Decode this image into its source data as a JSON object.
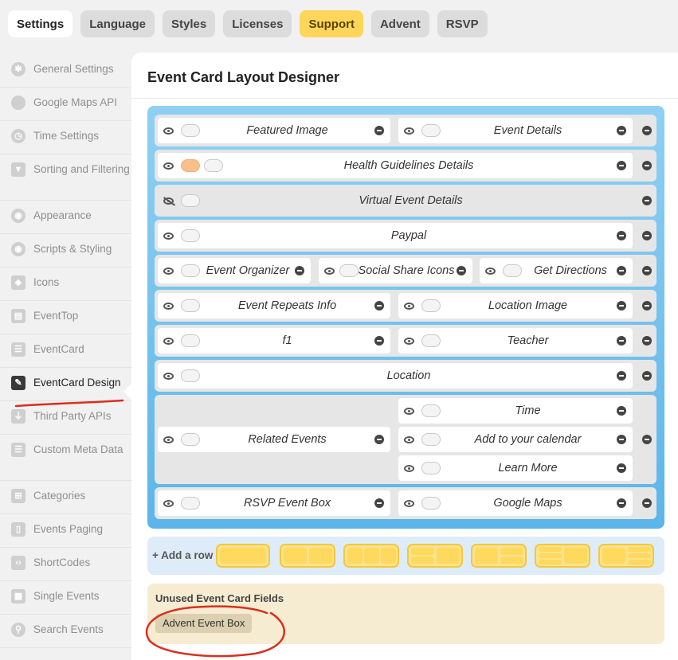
{
  "tabs": [
    "Settings",
    "Language",
    "Styles",
    "Licenses",
    "Support",
    "Advent",
    "RSVP"
  ],
  "sidebar": [
    {
      "label": "General Settings",
      "icon": "gear-icon"
    },
    {
      "label": "Google Maps API",
      "icon": "map-pin-icon"
    },
    {
      "label": "Time Settings",
      "icon": "clock-icon"
    },
    {
      "label": "Sorting and Filtering",
      "icon": "filter-icon"
    },
    {
      "label": "Appearance",
      "icon": "eye-icon"
    },
    {
      "label": "Scripts & Styling",
      "icon": "eye-icon"
    },
    {
      "label": "Icons",
      "icon": "diamond-icon"
    },
    {
      "label": "EventTop",
      "icon": "layout-icon"
    },
    {
      "label": "EventCard",
      "icon": "card-icon"
    },
    {
      "label": "EventCard Design",
      "icon": "design-tools-icon"
    },
    {
      "label": "Third Party APIs",
      "icon": "plug-icon"
    },
    {
      "label": "Custom Meta Data",
      "icon": "list-icon"
    },
    {
      "label": "Categories",
      "icon": "hierarchy-icon"
    },
    {
      "label": "Events Paging",
      "icon": "document-icon"
    },
    {
      "label": "ShortCodes",
      "icon": "code-icon"
    },
    {
      "label": "Single Events",
      "icon": "calendar-icon"
    },
    {
      "label": "Search Events",
      "icon": "search-icon"
    }
  ],
  "main": {
    "title": "Event Card Layout Designer",
    "rows": [
      [
        "Featured Image",
        "Event Details"
      ],
      [
        "Health Guidelines Details"
      ],
      [
        "Virtual Event Details"
      ],
      [
        "Paypal"
      ],
      [
        "Event Organizer",
        "Social Share Icons",
        "Get Directions"
      ],
      [
        "Event Repeats Info",
        "Location Image"
      ],
      [
        "f1",
        "Teacher"
      ],
      [
        "Location"
      ],
      [
        "Related Events",
        "Time",
        "Add to your calendar",
        "Learn More"
      ],
      [
        "RSVP Event Box",
        "Google Maps"
      ]
    ],
    "add_row_label": "+ Add a row",
    "unused_title": "Unused Event Card Fields",
    "unused_fields": [
      "Advent Event Box"
    ]
  },
  "colors": {
    "designer": "#5cb5ea",
    "support_tab": "#ffd65a",
    "annotation": "#d9301e"
  }
}
